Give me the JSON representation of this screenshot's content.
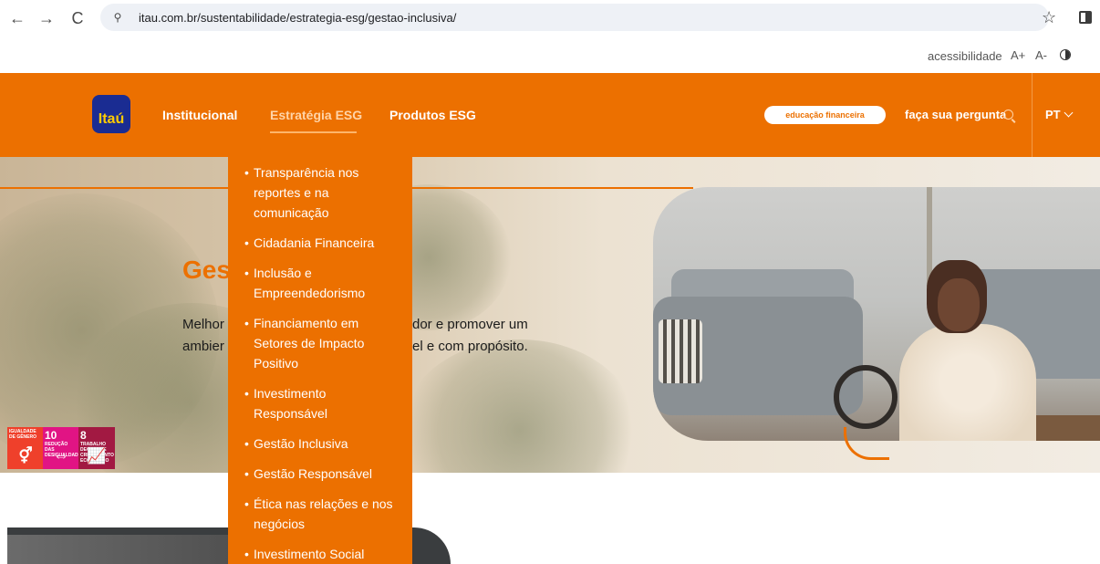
{
  "browser": {
    "back": "←",
    "forward": "→",
    "reload": "C",
    "site_info": "⚲",
    "url": "itau.com.br/sustentabilidade/estrategia-esg/gestao-inclusiva/",
    "star": "☆"
  },
  "accessibility": {
    "label": "acessibilidade",
    "increase": "A+",
    "decrease": "A-"
  },
  "header": {
    "logo_text": "Itaú",
    "nav": [
      {
        "label": "Institucional"
      },
      {
        "label": "Estratégia ESG"
      },
      {
        "label": "Produtos ESG"
      }
    ],
    "edu_button": "educação financeira",
    "ask": "faça sua pergunta",
    "language": "PT"
  },
  "hero": {
    "title": "Ges",
    "text_left_1": "Melhor",
    "text_left_2": "ambier",
    "text_right_1": "dor e promover um",
    "text_right_2": "el e com propósito."
  },
  "sdg": [
    {
      "num": "",
      "label": "IGUALDADE DE GÊNERO",
      "symbol": "⚥",
      "color": "#ef402b"
    },
    {
      "num": "10",
      "label": "REDUÇÃO DAS DESIGUALDADES",
      "symbol": "⇔",
      "color": "#e11484"
    },
    {
      "num": "8",
      "label": "TRABALHO DECENTE E CRESCIMENTO ECONÔMICO",
      "symbol": "📈",
      "color": "#a21942"
    }
  ],
  "dropdown": {
    "items": [
      "Transparência nos reportes e na comunicação",
      "Cidadania Financeira",
      "Inclusão e Empreendedorismo",
      "Financiamento em Setores de Impacto Positivo",
      "Investimento Responsável",
      "Gestão Inclusiva",
      "Gestão Responsável",
      "Ética nas relações e nos negócios",
      "Investimento Social"
    ]
  },
  "colors": {
    "brand_orange": "#ec7000",
    "logo_blue": "#1a2c92",
    "logo_yellow": "#ffcc00"
  }
}
